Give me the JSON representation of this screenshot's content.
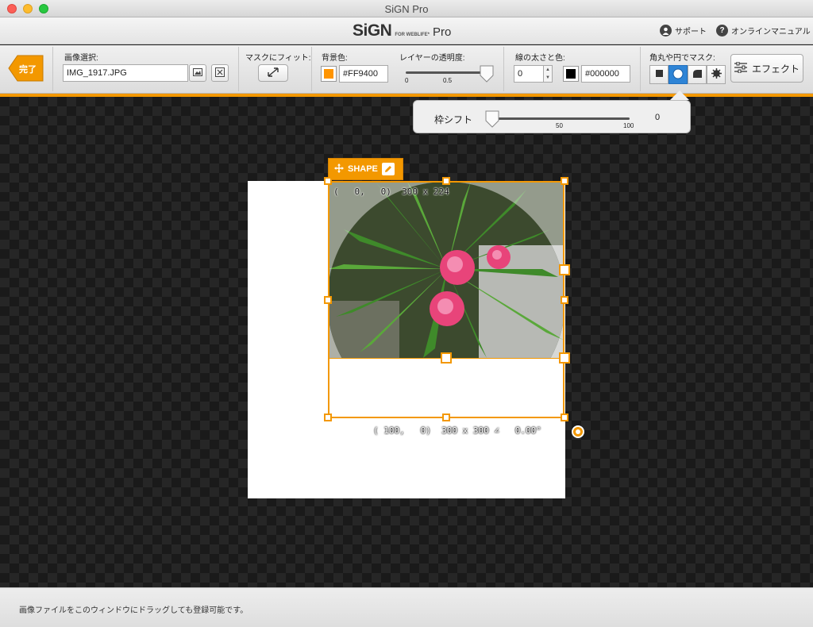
{
  "window": {
    "title": "SiGN Pro"
  },
  "header": {
    "logo_main": "SiGN",
    "logo_sub": "FOR WEBLIFE*",
    "logo_pro": "Pro",
    "support_label": "サポート",
    "manual_label": "オンラインマニュアル"
  },
  "toolbar": {
    "done_label": "完了",
    "image_select_label": "画像選択:",
    "filename": "IMG_1917.JPG",
    "fit_mask_label": "マスクにフィット:",
    "bg_color_label": "背景色:",
    "bg_color_value": "#FF9400",
    "opacity_label": "レイヤーの透明度:",
    "opacity_ticks": [
      "0",
      "0.5"
    ],
    "opacity_value": 1.0,
    "line_label": "線の太さと色:",
    "line_width": "0",
    "line_color_value": "#000000",
    "mask_label": "角丸や円でマスク:",
    "mask_selected": "circle",
    "effect_label": "エフェクト"
  },
  "popup": {
    "label": "枠シフト",
    "tick_50": "50",
    "tick_100": "100",
    "value": "0"
  },
  "canvas": {
    "shape_tab_label": "SHAPE",
    "image_coord": "(   0,   0)  300 x 224",
    "shape_coord": "( 100,   0)  300 x 300 ∠   0.00°"
  },
  "status": {
    "text": "画像ファイルをこのウィンドウにドラッグしても登録可能です。"
  },
  "colors": {
    "accent": "#f39800",
    "background_swatch": "#ff9400",
    "line_swatch": "#000000",
    "selected_segment": "#2e84d6"
  }
}
